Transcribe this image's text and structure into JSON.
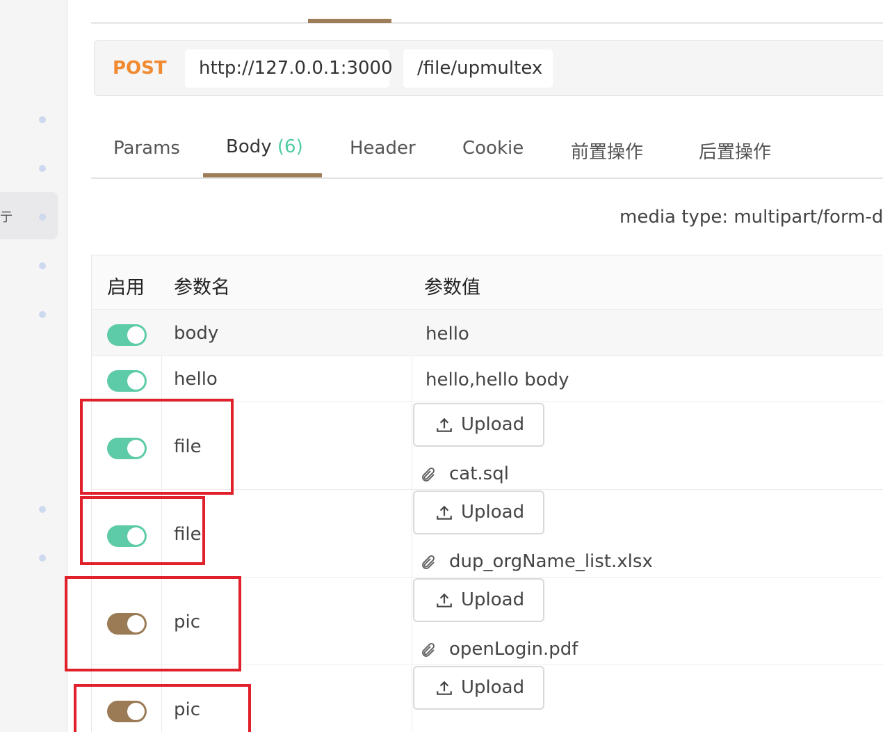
{
  "sidebar": {
    "items": [
      {
        "glyph": ""
      },
      {
        "glyph": ""
      },
      {
        "glyph": "亍"
      },
      {
        "glyph": ""
      },
      {
        "glyph": ""
      },
      {
        "glyph": ""
      },
      {
        "glyph": ""
      }
    ]
  },
  "request": {
    "method": "POST",
    "host": "http://127.0.0.1:3000",
    "path": "/file/upmultex"
  },
  "sub_tabs": {
    "params": "Params",
    "body": "Body",
    "body_count": "(6)",
    "header": "Header",
    "cookie": "Cookie",
    "pre_ops": "前置操作",
    "post_ops": "后置操作"
  },
  "media_type": "media type: multipart/form-data",
  "table": {
    "headers": {
      "enabled": "启用",
      "name": "参数名",
      "value": "参数值"
    },
    "rows": [
      {
        "enabled": true,
        "name": "body",
        "value": "hello"
      },
      {
        "enabled": true,
        "name": "hello",
        "value": "hello,hello body"
      },
      {
        "enabled": true,
        "name": "file",
        "upload_label": "Upload",
        "file": "cat.sql"
      },
      {
        "enabled": true,
        "name": "file",
        "upload_label": "Upload",
        "file": "dup_orgName_list.xlsx"
      },
      {
        "enabled": true,
        "name": "pic",
        "upload_label": "Upload",
        "file": "openLogin.pdf"
      },
      {
        "enabled": true,
        "name": "pic",
        "upload_label": "Upload",
        "file": ""
      }
    ]
  },
  "colors": {
    "method": "#f08a30",
    "accent": "#9e7e59",
    "toggle_on": "#5dcba8",
    "toggle_off": "#9a7b55",
    "count": "#4ecba3",
    "highlight": "#e0202a"
  }
}
